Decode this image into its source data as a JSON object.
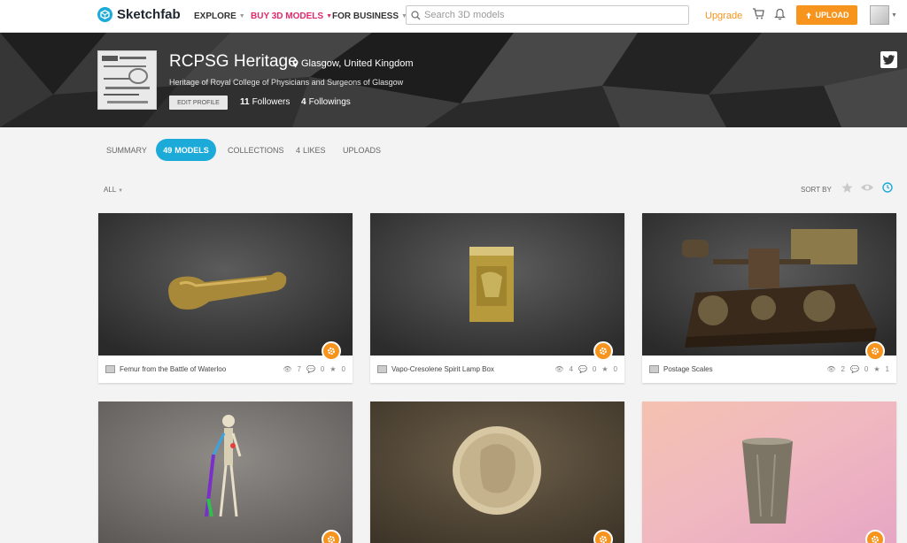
{
  "nav": {
    "logo": "Sketchfab",
    "explore": "EXPLORE",
    "buy": "BUY 3D MODELS",
    "business": "FOR BUSINESS",
    "search_placeholder": "Search 3D models",
    "upgrade": "Upgrade",
    "upload": "UPLOAD"
  },
  "profile": {
    "name": "RCPSG Heritage",
    "location": "Glasgow, United Kingdom",
    "description": "Heritage of Royal College of Physicians and Surgeons of Glasgow",
    "edit_label": "EDIT PROFILE",
    "followers_count": "11",
    "followers_label": "Followers",
    "followings_count": "4",
    "followings_label": "Followings"
  },
  "tabs": {
    "summary": "SUMMARY",
    "models_count": "49",
    "models_label": "MODELS",
    "collections": "COLLECTIONS",
    "likes_count": "4",
    "likes_label": "LIKES",
    "uploads": "UPLOADS"
  },
  "filters": {
    "all": "ALL",
    "sort_by": "SORT BY"
  },
  "models": [
    {
      "title": "Femur from the Battle of Waterloo",
      "views": "7",
      "comments": "0",
      "likes": "0"
    },
    {
      "title": "Vapo-Cresolene Spirit Lamp Box",
      "views": "4",
      "comments": "0",
      "likes": "0"
    },
    {
      "title": "Postage Scales",
      "views": "2",
      "comments": "0",
      "likes": "1"
    },
    {
      "title": "",
      "views": "",
      "comments": "",
      "likes": ""
    },
    {
      "title": "",
      "views": "",
      "comments": "",
      "likes": ""
    },
    {
      "title": "",
      "views": "",
      "comments": "",
      "likes": ""
    }
  ],
  "colors": {
    "brand": "#1caad9",
    "accent": "#f7941d",
    "buy": "#e0286a"
  }
}
